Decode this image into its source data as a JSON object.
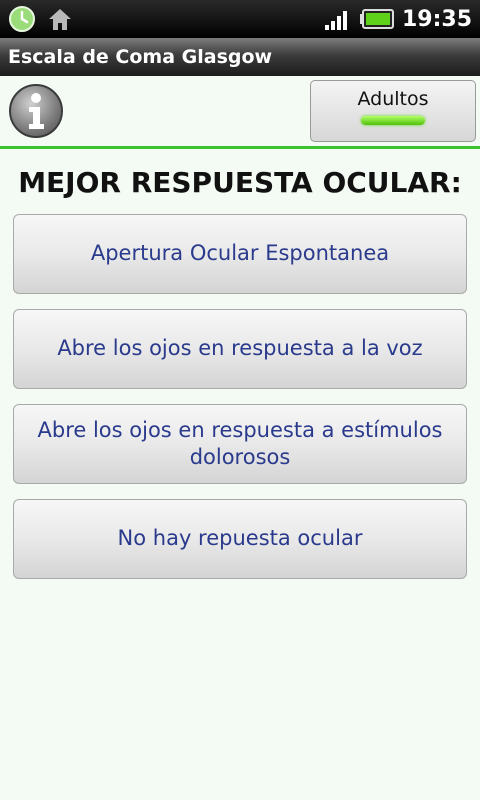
{
  "status_bar": {
    "time": "19:35"
  },
  "title_bar": {
    "title": "Escala de Coma Glasgow"
  },
  "mode": {
    "label": "Adultos"
  },
  "question": {
    "title": "MEJOR RESPUESTA OCULAR:"
  },
  "options": [
    {
      "label": "Apertura Ocular Espontanea"
    },
    {
      "label": "Abre los ojos en respuesta a la voz"
    },
    {
      "label": "Abre los ojos en respuesta a estímulos dolorosos"
    },
    {
      "label": "No hay repuesta ocular"
    }
  ]
}
